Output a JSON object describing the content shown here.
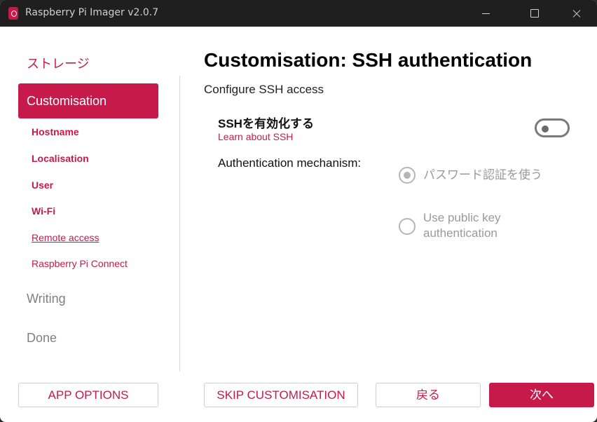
{
  "window": {
    "title": "Raspberry Pi Imager v2.0.7",
    "icon": "raspberry-app-icon",
    "controls": [
      "minimize-icon",
      "maximize-icon",
      "close-icon"
    ]
  },
  "sidebar": {
    "storage_label": "ストレージ",
    "active_label": "Customisation",
    "sub_items": [
      "Hostname",
      "Localisation",
      "User",
      "Wi-Fi",
      "Remote access",
      "Raspberry Pi Connect"
    ],
    "writing_label": "Writing",
    "done_label": "Done"
  },
  "main": {
    "heading": "Customisation: SSH authentication",
    "subheading": "Configure SSH access",
    "ssh_enable_label": "SSHを有効化する",
    "ssh_link": "Learn about SSH",
    "ssh_enabled": false,
    "auth_label": "Authentication mechanism:",
    "auth_options": [
      "パスワード認証を使う",
      "Use public key authentication"
    ],
    "auth_selected": "パスワード認証を使う"
  },
  "footer": {
    "app_options": "APP OPTIONS",
    "skip": "SKIP CUSTOMISATION",
    "back": "戻る",
    "next": "次へ"
  },
  "colors": {
    "accent": "#c51a4a",
    "titlebar": "#1f1f1f",
    "disabled_text": "#9a9a9a"
  }
}
